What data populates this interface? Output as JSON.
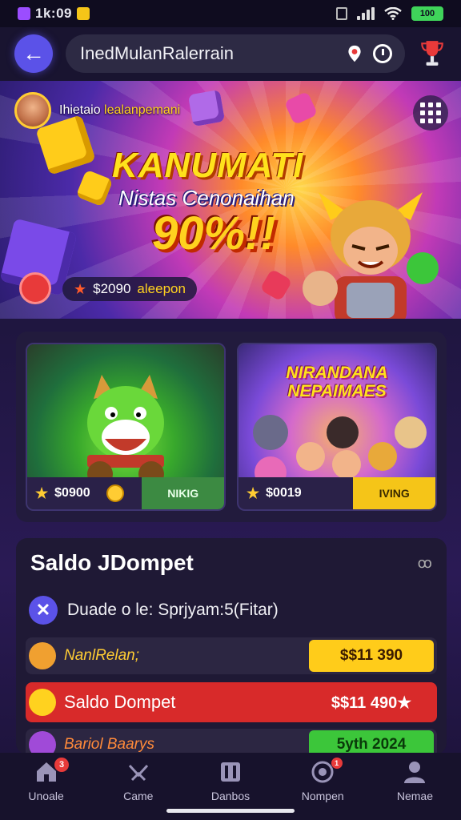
{
  "status_bar": {
    "time": "1k:09",
    "battery": "100"
  },
  "top_bar": {
    "search_value": "InedMulanRalerrain"
  },
  "hero": {
    "tag_prefix": "Ihietaio ",
    "tag_highlight": "lealanpemani",
    "title": "KANUMATI",
    "subtitle": "Nistas Cenonaihan",
    "percent": "90%!!",
    "badge_amount": "$2090",
    "badge_code": "aleepon"
  },
  "games": [
    {
      "title": "",
      "amount": "$0900",
      "action": "NIKIG"
    },
    {
      "title": "NIRANDANA NEPAIMAES",
      "amount": "$0019",
      "action": "IVING"
    }
  ],
  "wallet": {
    "title": "Saldo JDompet",
    "link": "ꝏ",
    "description": "Duade o le: Sprjyam:5(Fitar)",
    "rows": [
      {
        "label": "NanlRelan;",
        "value": "$$11 390"
      },
      {
        "label": "Saldo Dompet",
        "value": "$$11 490★"
      },
      {
        "label": "Bariol Baarys",
        "value": "5yth 2024"
      }
    ]
  },
  "bottom_nav": [
    {
      "label": "Unoale",
      "badge": "3"
    },
    {
      "label": "Came",
      "badge": ""
    },
    {
      "label": "Danbos",
      "badge": ""
    },
    {
      "label": "Nompen",
      "badge": "1"
    },
    {
      "label": "Nemae",
      "badge": ""
    }
  ],
  "colors": {
    "accent": "#5b52e8",
    "gold": "#ffcc1a",
    "red": "#d82a2a",
    "green": "#3cc63a"
  }
}
